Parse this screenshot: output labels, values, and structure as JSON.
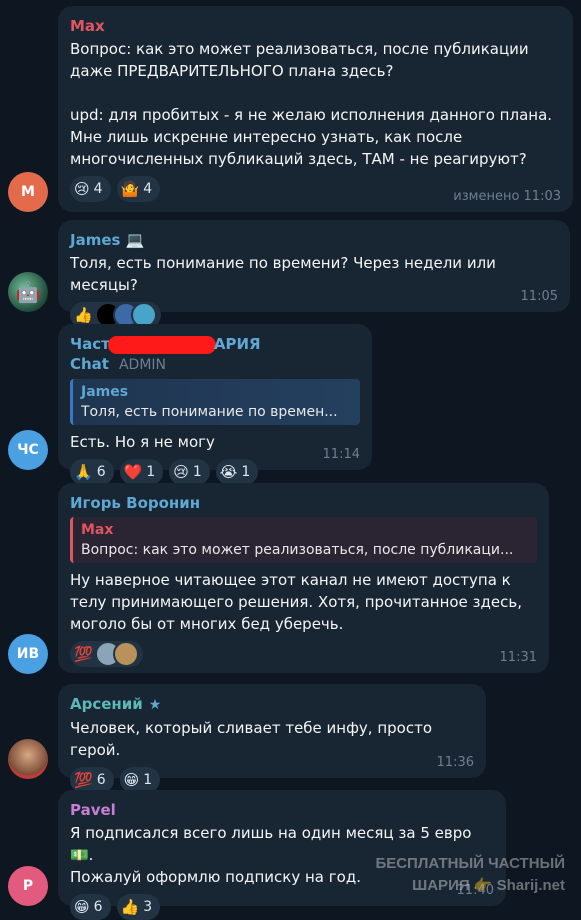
{
  "messages": [
    {
      "avatar": "M",
      "sender": "Max",
      "text": "Вопрос: как это может реализоваться, после публикации даже ПРЕДВАРИТЕЛЬНОГО плана здесь?\n\nupd: для пробитых - я не желаю исполнения данного плана. Мне лишь искренне интересно узнать, как после многочисленных публикаций здесь, ТАМ - не реагируют?",
      "reactions": [
        {
          "emoji": "😢",
          "count": "4"
        },
        {
          "emoji": "🤷",
          "count": "4"
        }
      ],
      "time": "изменено 11:03"
    },
    {
      "avatar": "",
      "sender": "James 💻",
      "text": "Толя, есть понимание по времени? Через недели или месяцы?",
      "reactions": [
        {
          "emoji": "👍",
          "count": ""
        }
      ],
      "time": "11:05"
    },
    {
      "avatar": "ЧС",
      "sender_prefix": "Част",
      "sender_suffix": "АРИЯ Chat",
      "admin": "ADMIN",
      "quote_name": "James",
      "quote_text": "Толя, есть понимание по времен...",
      "text": "Есть. Но я не могу",
      "reactions": [
        {
          "emoji": "🙏",
          "count": "6"
        },
        {
          "emoji": "❤️",
          "count": "1"
        },
        {
          "emoji": "😢",
          "count": "1"
        },
        {
          "emoji": "😭",
          "count": "1"
        }
      ],
      "time": "11:14"
    },
    {
      "avatar": "ИВ",
      "sender": "Игорь Воронин",
      "quote_name": "Max",
      "quote_text": "Вопрос: как это может реализоваться, после публикаци...",
      "text": "Ну наверное читающее этот канал не имеют доступа к телу принимающего решения. Хотя, прочитанное здесь, моголо бы от многих бед уберечь.",
      "reactions": [
        {
          "emoji": "💯",
          "count": ""
        }
      ],
      "time": "11:31"
    },
    {
      "avatar": "",
      "sender": "Арсений",
      "text": "Человек, который сливает тебе инфу, просто герой.",
      "reactions": [
        {
          "emoji": "💯",
          "count": "6"
        },
        {
          "emoji": "😁",
          "count": "1"
        }
      ],
      "time": "11:36"
    },
    {
      "avatar": "P",
      "sender": "Pavel",
      "text": "Я подписался всего лишь на один месяц за 5 евро 💵.\nПожалуй оформлю подписку на год.",
      "reactions": [
        {
          "emoji": "😁",
          "count": "6"
        },
        {
          "emoji": "👍",
          "count": "3"
        }
      ],
      "time": "11:40"
    }
  ],
  "watermark": {
    "line1": "БЕСПЛАТНЫЙ ЧАСТНЫЙ",
    "line2": "ШАРИЯ 👉 Sharij.net"
  },
  "colors": {
    "background": "#0e1621",
    "bubble": "#182533",
    "max_name": "#e05560",
    "james_name": "#5fa8d3",
    "admin_name": "#5fa8d3",
    "igor_name": "#5fa8d3",
    "arseniy_name": "#5fb8b8",
    "pavel_name": "#c57fd3"
  }
}
